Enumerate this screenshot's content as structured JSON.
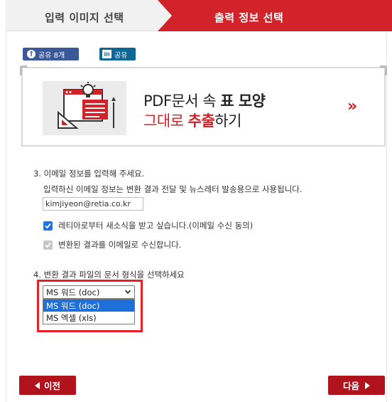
{
  "tabs": {
    "step1_label": "입력 이미지 선택",
    "step2_label": "출력 정보 선택",
    "active_color": "#d2232a"
  },
  "share": {
    "facebook_label": "공유 8개",
    "linkedin_label": "공유",
    "facebook_icon": "facebook-icon",
    "linkedin_icon": "linkedin-icon"
  },
  "banner": {
    "line1_prefix": "PDF문서 속 ",
    "line1_bold": "표 모양",
    "line2_red": "그대로 ",
    "line2_red_bold": "추출",
    "line2_suffix": "하기",
    "arrow": "»"
  },
  "email_section": {
    "question": "3. 이메일 정보를 입력해 주세요.",
    "description": "입력하신 이메일 정보는 변환 결과 전달 및 뉴스레터 발송용으로 사용됩니다.",
    "email_value": "kimjiyeon@retia.co.kr"
  },
  "options": {
    "newsletter_label": "레티아로부터 새소식을 받고 싶습니다.(이메일 수신 동의)",
    "newsletter_checked": true,
    "result_email_label": "변환된 결과를 이메일로 수신합니다.",
    "result_email_checked": true,
    "result_email_disabled": true
  },
  "format_section": {
    "question": "4. 변환 결과 파일의 문서 형식을 선택하세요",
    "selected_value": "MS 워드 (doc)",
    "dropdown_options": [
      "MS 워드 (doc)",
      "MS 엑셀 (xls)"
    ],
    "highlighted_option_index": 0
  },
  "navigation": {
    "prev_label": "이전",
    "next_label": "다음",
    "button_color": "#b0131b"
  }
}
